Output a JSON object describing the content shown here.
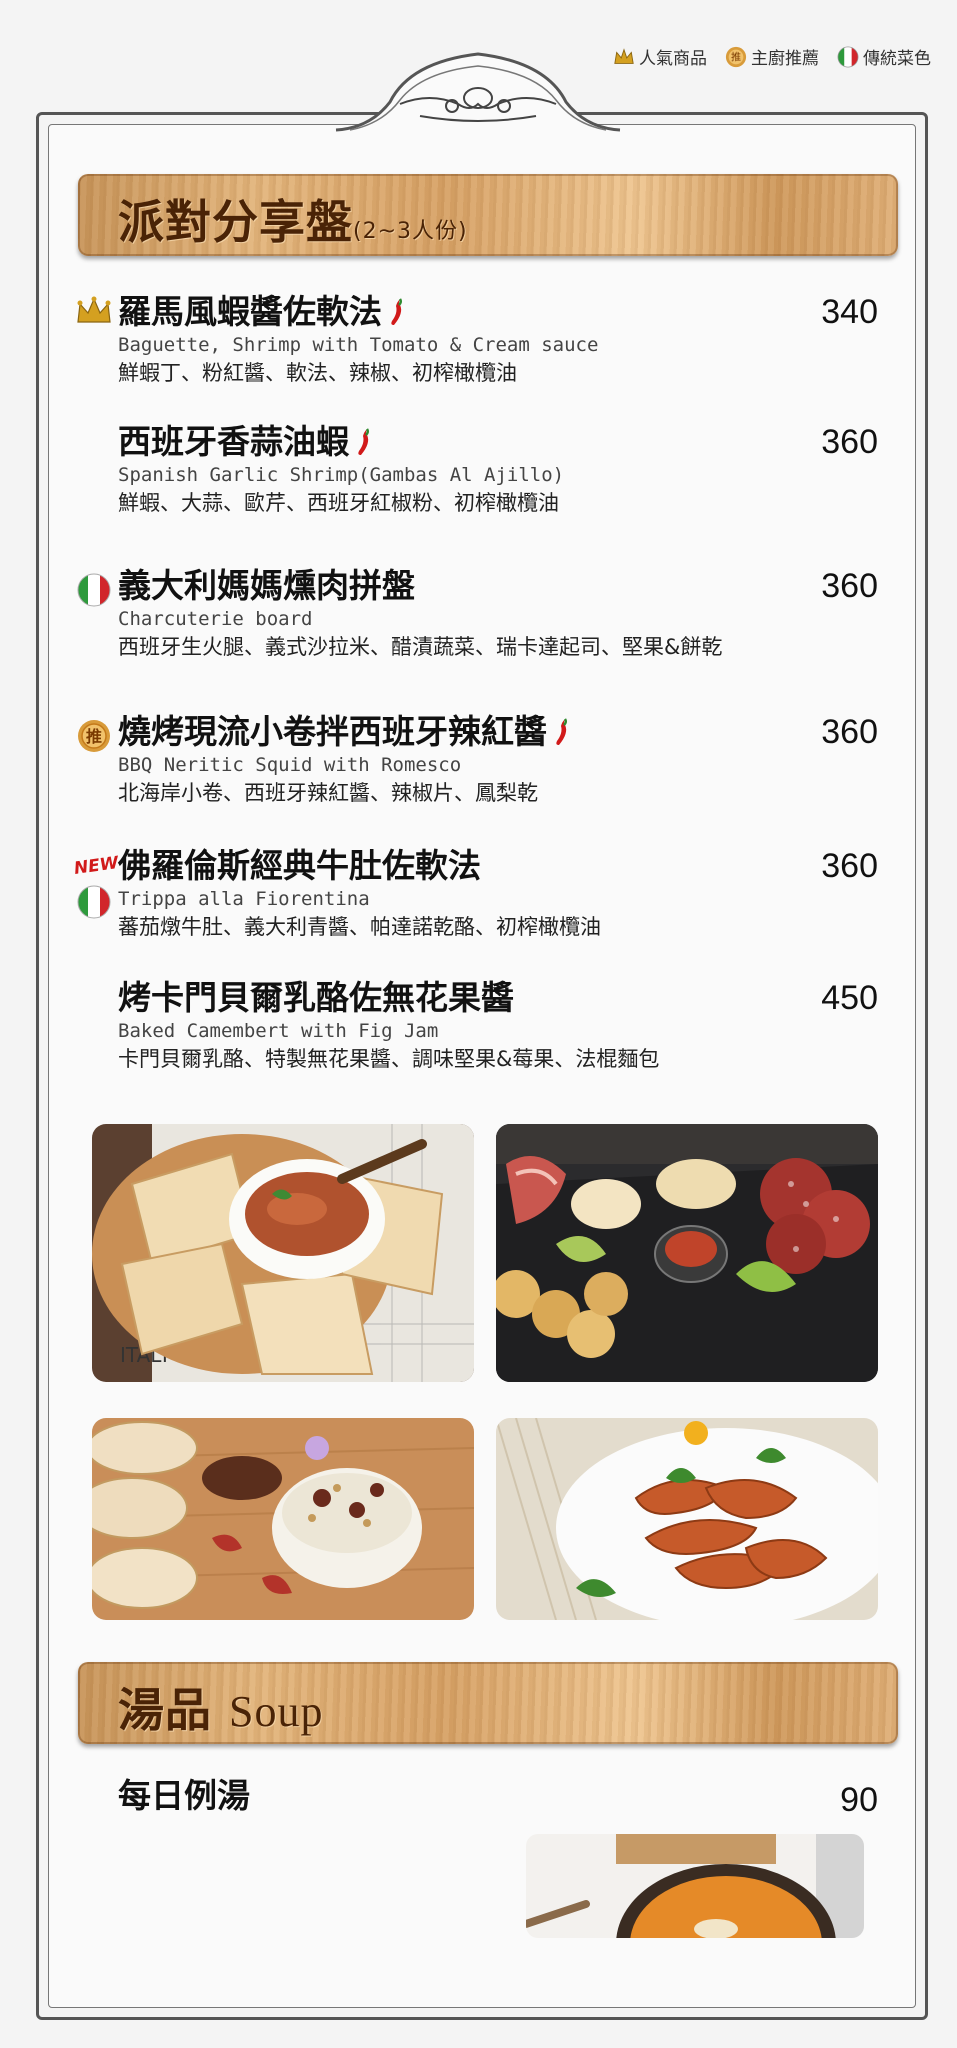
{
  "legend": [
    {
      "icon": "crown-icon",
      "label": "人氣商品"
    },
    {
      "icon": "chef-recommend-icon",
      "label": "主廚推薦"
    },
    {
      "icon": "italy-flag-icon",
      "label": "傳統菜色"
    }
  ],
  "sections": {
    "party": {
      "title": "派對分享盤",
      "subtitle": "(2~3人份)"
    },
    "soup": {
      "title": "湯品",
      "title_en": "Soup"
    }
  },
  "recommend_badge": "推",
  "new_badge": "NEW",
  "items": [
    {
      "name": "羅馬風蝦醬佐軟法",
      "en": "Baguette, Shrimp with Tomato & Cream  sauce",
      "desc": "鮮蝦丁、粉紅醬、軟法、辣椒、初榨橄欖油",
      "price": "340",
      "markers": [
        "crown-icon"
      ],
      "spicy": true
    },
    {
      "name": "西班牙香蒜油蝦",
      "en": "Spanish Garlic Shrimp(Gambas Al Ajillo)",
      "desc": "鮮蝦、大蒜、歐芹、西班牙紅椒粉、初榨橄欖油",
      "price": "360",
      "markers": [],
      "spicy": true
    },
    {
      "name": "義大利媽媽燻肉拼盤",
      "en": "Charcuterie board",
      "desc": "西班牙生火腿、義式沙拉米、醋漬蔬菜、瑞卡達起司、堅果&餅乾",
      "price": "360",
      "markers": [
        "italy-flag-icon"
      ],
      "spicy": false
    },
    {
      "name": "燒烤現流小卷拌西班牙辣紅醬",
      "en": "BBQ Neritic Squid with Romesco",
      "desc": "北海岸小卷、西班牙辣紅醬、辣椒片、鳳梨乾",
      "price": "360",
      "markers": [
        "chef-recommend-icon"
      ],
      "spicy": true
    },
    {
      "name": "佛羅倫斯經典牛肚佐軟法",
      "en": "Trippa alla Fiorentina",
      "desc": "蕃茄燉牛肚、義大利青醬、帕達諾乾酪、初榨橄欖油",
      "price": "360",
      "markers": [
        "new-badge",
        "italy-flag-icon"
      ],
      "spicy": false
    },
    {
      "name": "烤卡門貝爾乳酪佐無花果醬",
      "en": "Baked Camembert with Fig Jam",
      "desc": "卡門貝爾乳酪、特製無花果醬、調味堅果&莓果、法棍麵包",
      "price": "450",
      "markers": [],
      "spicy": false
    }
  ],
  "soup_item": {
    "name": "每日例湯",
    "price": "90"
  },
  "photo_text": {
    "italy_paper": "ITALY"
  },
  "colors": {
    "wood": "#d9a466",
    "banner_text": "#4a2306",
    "chili": "#d11a1a",
    "crown": "#d4a020",
    "flag_green": "#2e9a3c",
    "flag_red": "#d1262b"
  }
}
